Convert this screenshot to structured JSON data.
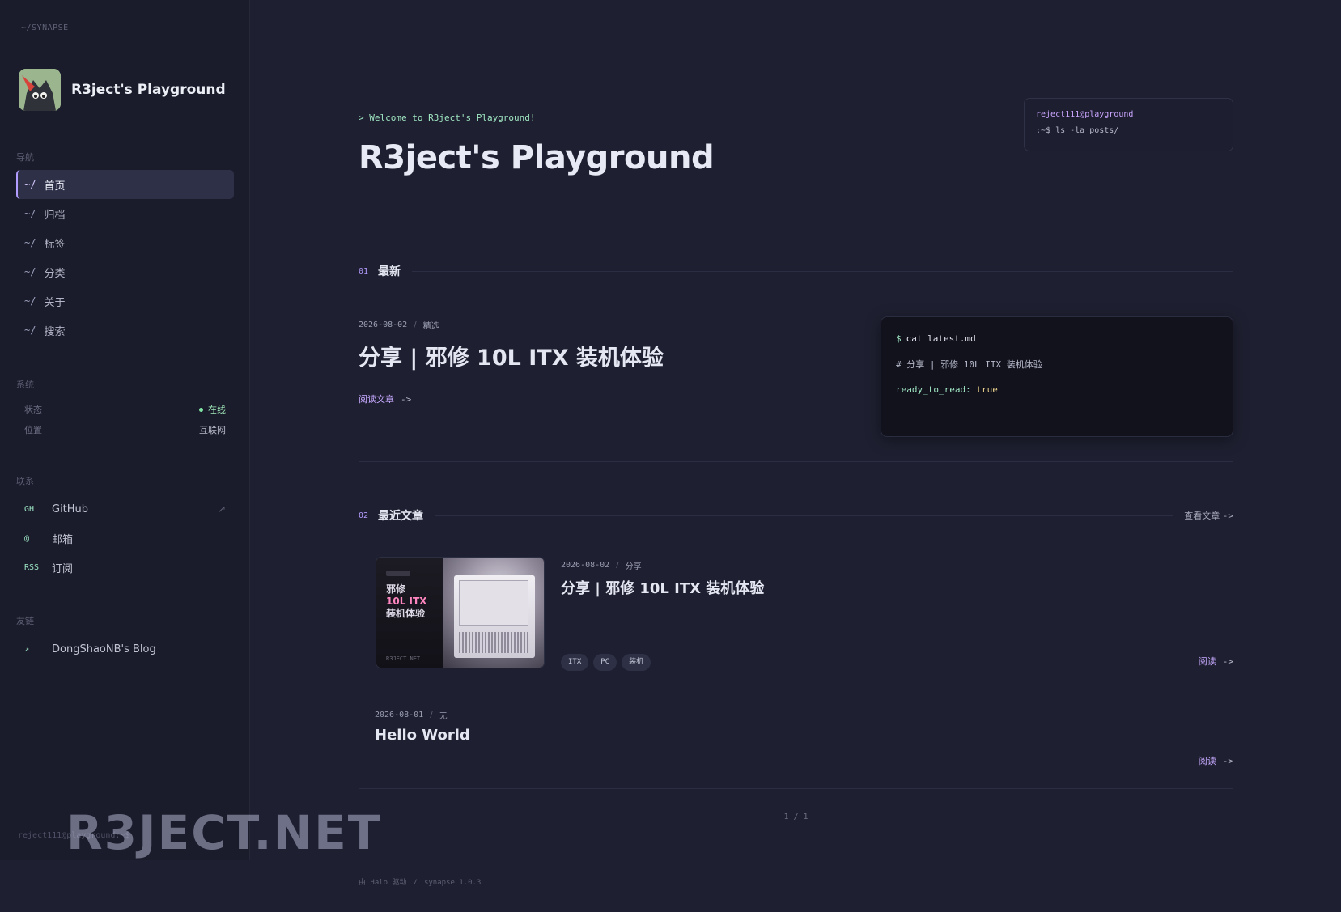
{
  "sidebar": {
    "brand_path": "~/SYNAPSE",
    "site_name": "R3ject's Playground",
    "nav_label": "导航",
    "nav_prefix": "~/",
    "nav_items": [
      {
        "label": "首页"
      },
      {
        "label": "归档"
      },
      {
        "label": "标签"
      },
      {
        "label": "分类"
      },
      {
        "label": "关于"
      },
      {
        "label": "搜索"
      }
    ],
    "system_label": "系统",
    "status_label": "状态",
    "status_value": "在线",
    "location_label": "位置",
    "location_value": "互联网",
    "contact_label": "联系",
    "contacts": [
      {
        "tag": "GH",
        "label": "GitHub",
        "ext": "↗"
      },
      {
        "tag": "@",
        "label": "邮箱"
      },
      {
        "tag": "RSS",
        "label": "订阅"
      }
    ],
    "friends_label": "友链",
    "friends": [
      {
        "tag": "↗",
        "label": "DongShaoNB's Blog"
      }
    ],
    "footer_user": "reject111@playground:~$"
  },
  "hero": {
    "welcome": "> Welcome to R3ject's Playground!",
    "title": "R3ject's Playground",
    "terminal_user": "reject111@playground",
    "terminal_cmd": ":~$ ls -la posts/"
  },
  "latest": {
    "num": "01",
    "title": "最新",
    "date": "2026-08-02",
    "category": "精选",
    "post_title": "分享 | 邪修 10L ITX 装机体验",
    "read_label": "阅读文章",
    "arrow": "->",
    "code_prompt": "$",
    "code_cmd": "cat latest.md",
    "code_heading": "# 分享 | 邪修 10L ITX 装机体验",
    "code_key": "ready_to_read:",
    "code_val": "true"
  },
  "recent": {
    "num": "02",
    "title": "最近文章",
    "view_all": "查看文章",
    "arrow": "->",
    "posts": [
      {
        "date": "2026-08-02",
        "category": "分享",
        "title": "分享 | 邪修 10L ITX 装机体验",
        "tags": [
          "ITX",
          "PC",
          "装机"
        ],
        "read": "阅读",
        "thumb_badge": "",
        "thumb_line1": "邪修",
        "thumb_line2": "10L ITX",
        "thumb_line3": "装机体验",
        "thumb_footer": "R3JECT.NET"
      },
      {
        "date": "2026-08-01",
        "category": "无",
        "title": "Hello World",
        "read": "阅读"
      }
    ],
    "pager": "1 / 1"
  },
  "footer": {
    "powered": "由 Halo 驱动",
    "version": "synapse 1.0.3"
  },
  "watermark": "R3JECT.NET",
  "colors": {
    "background": "#1e1f30",
    "sidebar": "#1b1c2b",
    "accent_purple": "#b29cff",
    "accent_green": "#9fe6c2"
  }
}
